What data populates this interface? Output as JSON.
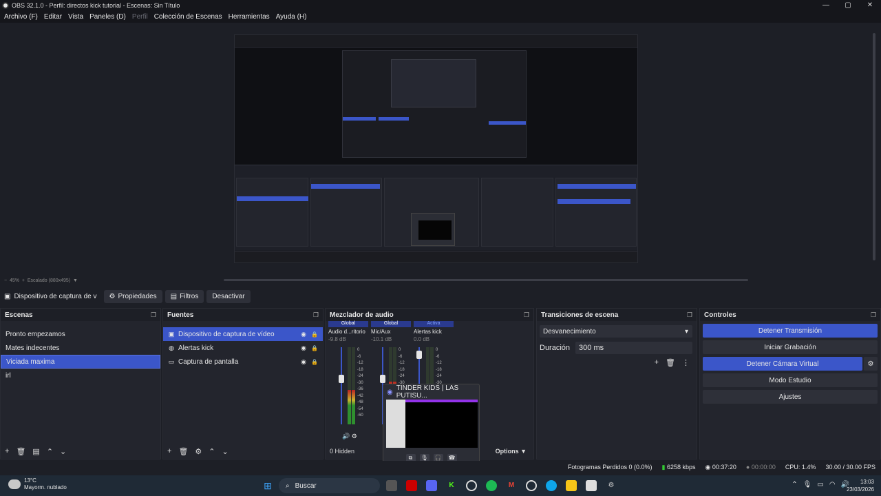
{
  "window": {
    "title": "OBS 32.1.0 - Perfil: directos kick tutorial - Escenas: Sin Título",
    "controls": [
      "—",
      "▢",
      "✕"
    ]
  },
  "menu": [
    "Archivo (F)",
    "Editar",
    "Vista",
    "Paneles (D)",
    "Perfil",
    "Colección de Escenas",
    "Herramientas",
    "Ayuda (H)"
  ],
  "zoom": {
    "label": "45%",
    "scale": "Escalado (880x495)"
  },
  "source_toolbar": {
    "selected_source": "Dispositivo de captura de v",
    "properties": "Propiedades",
    "filters": "Filtros",
    "deactivate": "Desactivar"
  },
  "scenes": {
    "title": "Escenas",
    "items": [
      "Pronto empezamos",
      "Mates indecentes",
      "Viciada maxima",
      "irl"
    ],
    "selected_index": 2
  },
  "sources": {
    "title": "Fuentes",
    "items": [
      {
        "name": "Dispositivo de captura de vídeo",
        "icon": "camera-icon",
        "selected": true
      },
      {
        "name": "Alertas kick",
        "icon": "globe-icon",
        "selected": false
      },
      {
        "name": "Captura de pantalla",
        "icon": "monitor-icon",
        "selected": false
      }
    ]
  },
  "mixer": {
    "title": "Mezclador de audio",
    "channels": [
      {
        "tag": "Global",
        "name": "Audio d...ritorio",
        "db": "-9.8 dB",
        "level": 0.45,
        "fader": 0.6
      },
      {
        "tag": "Global",
        "name": "Mic/Aux",
        "db": "-10.1 dB",
        "level": 0.55,
        "fader": 0.6
      },
      {
        "tag": "Activa",
        "name": "Alertas kick",
        "db": "0.0 dB",
        "level": 0.4,
        "fader": 0.95
      }
    ],
    "scale": [
      "0",
      "-6",
      "-12",
      "-18",
      "-24",
      "-30",
      "-36",
      "-42",
      "-48",
      "-54",
      "-60"
    ],
    "hidden_label": "0 Hidden",
    "options_label": "Options"
  },
  "transitions": {
    "title": "Transiciones de escena",
    "type": "Desvanecimiento",
    "duration_label": "Duración",
    "duration_value": "300 ms"
  },
  "controls": {
    "title": "Controles",
    "stop_stream": "Detener Transmisión",
    "start_recording": "Iniciar Grabación",
    "stop_virtualcam": "Detener Cámara Virtual",
    "studio_mode": "Modo Estudio",
    "settings": "Ajustes"
  },
  "popup": {
    "title": "TINDER KIDS | LAS PUTISU..."
  },
  "status": {
    "dropped": "Fotogramas Perdidos 0 (0.0%)",
    "bitrate": "6258 kbps",
    "stream_time": "00:37:20",
    "rec_time": "00:00:00",
    "cpu": "CPU: 1.4%",
    "fps": "30.00 / 30.00 FPS"
  },
  "taskbar": {
    "temp": "13°C",
    "weather": "Mayorm. nublado",
    "search": "Buscar",
    "time": "13:03",
    "date": "23/03/2026"
  },
  "colors": {
    "accent": "#3b56c9",
    "panel": "#23252d",
    "bg": "#1d1f26"
  }
}
